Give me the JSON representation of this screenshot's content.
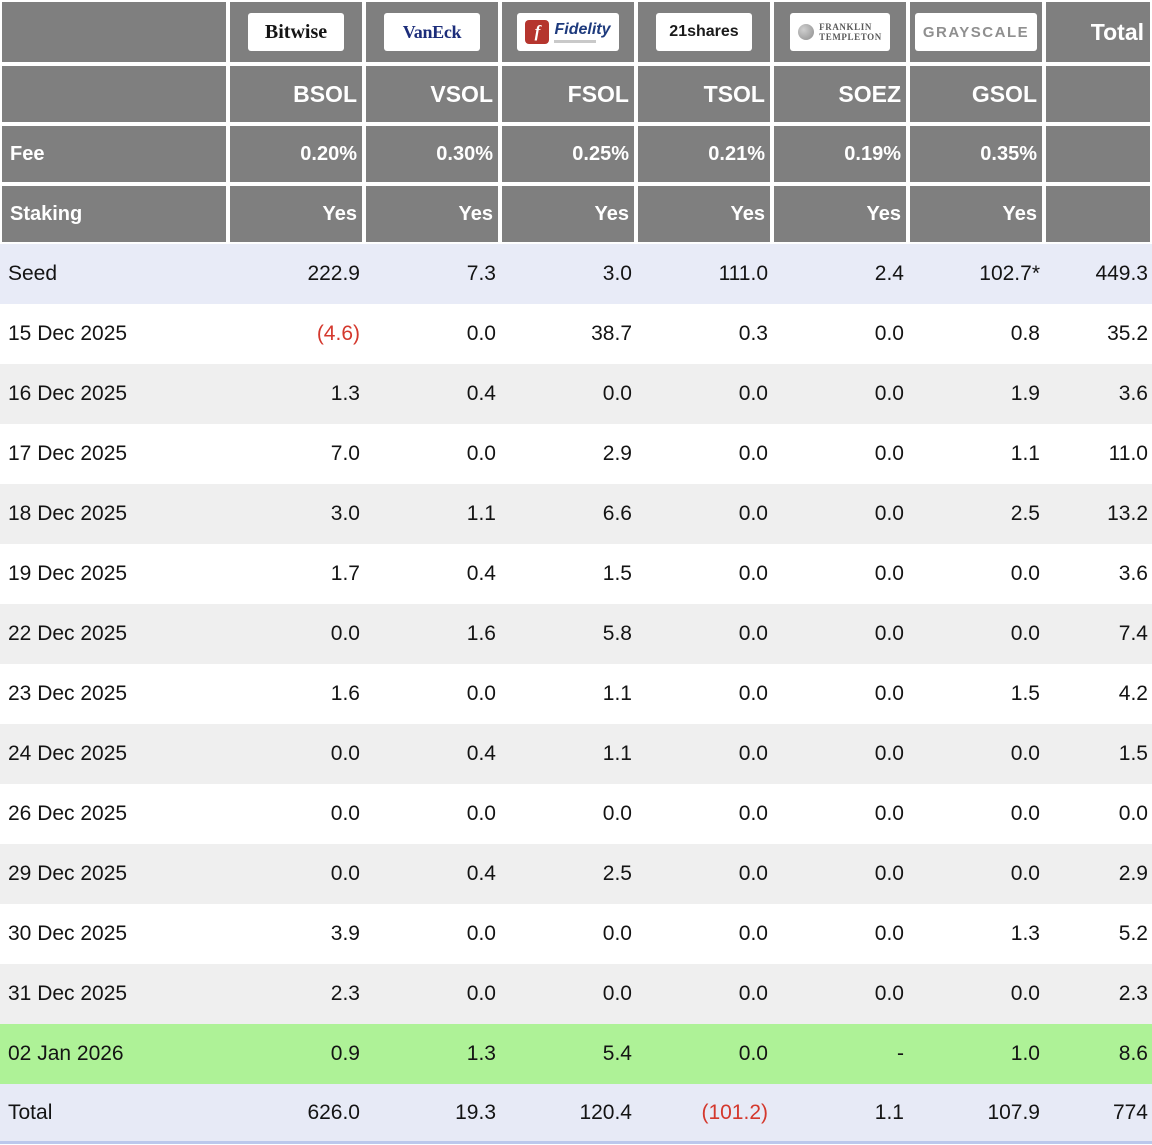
{
  "chart_data": {
    "type": "table",
    "title": "",
    "issuers": [
      {
        "name": "Bitwise",
        "ticker": "BSOL",
        "fee": "0.20%",
        "staking": "Yes"
      },
      {
        "name": "VanEck",
        "ticker": "VSOL",
        "fee": "0.30%",
        "staking": "Yes"
      },
      {
        "name": "Fidelity",
        "ticker": "FSOL",
        "fee": "0.25%",
        "staking": "Yes"
      },
      {
        "name": "21shares",
        "ticker": "TSOL",
        "fee": "0.21%",
        "staking": "Yes"
      },
      {
        "name": "Franklin Templeton",
        "logo_line1": "FRANKLIN",
        "logo_line2": "TEMPLETON",
        "ticker": "SOEZ",
        "fee": "0.19%",
        "staking": "Yes"
      },
      {
        "name": "GRAYSCALE",
        "ticker": "GSOL",
        "fee": "0.35%",
        "staking": "Yes"
      }
    ],
    "labels": {
      "fee": "Fee",
      "staking": "Staking",
      "total_column": "Total"
    },
    "rows": [
      {
        "label": "Seed",
        "values": [
          "222.9",
          "7.3",
          "3.0",
          "111.0",
          "2.4",
          "102.7*",
          "449.3"
        ],
        "style": "seed"
      },
      {
        "label": "15 Dec 2025",
        "values": [
          "(4.6)",
          "0.0",
          "38.7",
          "0.3",
          "0.0",
          "0.8",
          "35.2"
        ],
        "style": "white"
      },
      {
        "label": "16 Dec 2025",
        "values": [
          "1.3",
          "0.4",
          "0.0",
          "0.0",
          "0.0",
          "1.9",
          "3.6"
        ],
        "style": "stripe"
      },
      {
        "label": "17 Dec 2025",
        "values": [
          "7.0",
          "0.0",
          "2.9",
          "0.0",
          "0.0",
          "1.1",
          "11.0"
        ],
        "style": "white"
      },
      {
        "label": "18 Dec 2025",
        "values": [
          "3.0",
          "1.1",
          "6.6",
          "0.0",
          "0.0",
          "2.5",
          "13.2"
        ],
        "style": "stripe"
      },
      {
        "label": "19 Dec 2025",
        "values": [
          "1.7",
          "0.4",
          "1.5",
          "0.0",
          "0.0",
          "0.0",
          "3.6"
        ],
        "style": "white"
      },
      {
        "label": "22 Dec 2025",
        "values": [
          "0.0",
          "1.6",
          "5.8",
          "0.0",
          "0.0",
          "0.0",
          "7.4"
        ],
        "style": "stripe"
      },
      {
        "label": "23 Dec 2025",
        "values": [
          "1.6",
          "0.0",
          "1.1",
          "0.0",
          "0.0",
          "1.5",
          "4.2"
        ],
        "style": "white"
      },
      {
        "label": "24 Dec 2025",
        "values": [
          "0.0",
          "0.4",
          "1.1",
          "0.0",
          "0.0",
          "0.0",
          "1.5"
        ],
        "style": "stripe"
      },
      {
        "label": "26 Dec 2025",
        "values": [
          "0.0",
          "0.0",
          "0.0",
          "0.0",
          "0.0",
          "0.0",
          "0.0"
        ],
        "style": "white"
      },
      {
        "label": "29 Dec 2025",
        "values": [
          "0.0",
          "0.4",
          "2.5",
          "0.0",
          "0.0",
          "0.0",
          "2.9"
        ],
        "style": "stripe"
      },
      {
        "label": "30 Dec 2025",
        "values": [
          "3.9",
          "0.0",
          "0.0",
          "0.0",
          "0.0",
          "1.3",
          "5.2"
        ],
        "style": "white"
      },
      {
        "label": "31 Dec 2025",
        "values": [
          "2.3",
          "0.0",
          "0.0",
          "0.0",
          "0.0",
          "0.0",
          "2.3"
        ],
        "style": "stripe"
      },
      {
        "label": "02 Jan 2026",
        "values": [
          "0.9",
          "1.3",
          "5.4",
          "0.0",
          "-",
          "1.0",
          "8.6"
        ],
        "style": "green"
      },
      {
        "label": "Total",
        "values": [
          "626.0",
          "19.3",
          "120.4",
          "(101.2)",
          "1.1",
          "107.9",
          "774"
        ],
        "style": "total"
      }
    ],
    "colors": {
      "header_bg": "#7f7f7f",
      "stripe_row": "#efefef",
      "seed_total_row": "#e7eaf6",
      "highlight_green_row": "#aef297",
      "negative_text": "#d4382d",
      "fidelity_red": "#b5352e",
      "vaneck_blue": "#1c2d7a"
    }
  }
}
